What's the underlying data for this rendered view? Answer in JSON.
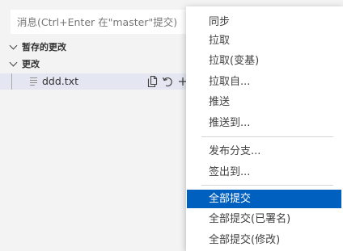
{
  "scm": {
    "commit_placeholder": "消息(Ctrl+Enter 在\"master\"提交)",
    "groups": {
      "staged_label": "暂存的更改",
      "changes_label": "更改"
    },
    "changes": [
      {
        "name": "ddd.txt",
        "actions": [
          "open-file-icon",
          "discard-changes-icon",
          "stage-changes-icon"
        ]
      }
    ]
  },
  "context_menu": {
    "items": [
      {
        "label": "同步"
      },
      {
        "label": "拉取"
      },
      {
        "label": "拉取(变基)"
      },
      {
        "label": "拉取自..."
      },
      {
        "label": "推送"
      },
      {
        "label": "推送到..."
      },
      {
        "label": "发布分支..."
      },
      {
        "label": "签出到..."
      },
      {
        "label": "全部提交"
      },
      {
        "label": "全部提交(已署名)"
      },
      {
        "label": "全部提交(修改)"
      }
    ],
    "highlighted_item": "全部提交"
  },
  "colors": {
    "sidebar_background": "#f3f3f3",
    "selected_row": "#e4e6f1",
    "menu_highlight": "#0060c0",
    "menu_text": "#424242"
  }
}
